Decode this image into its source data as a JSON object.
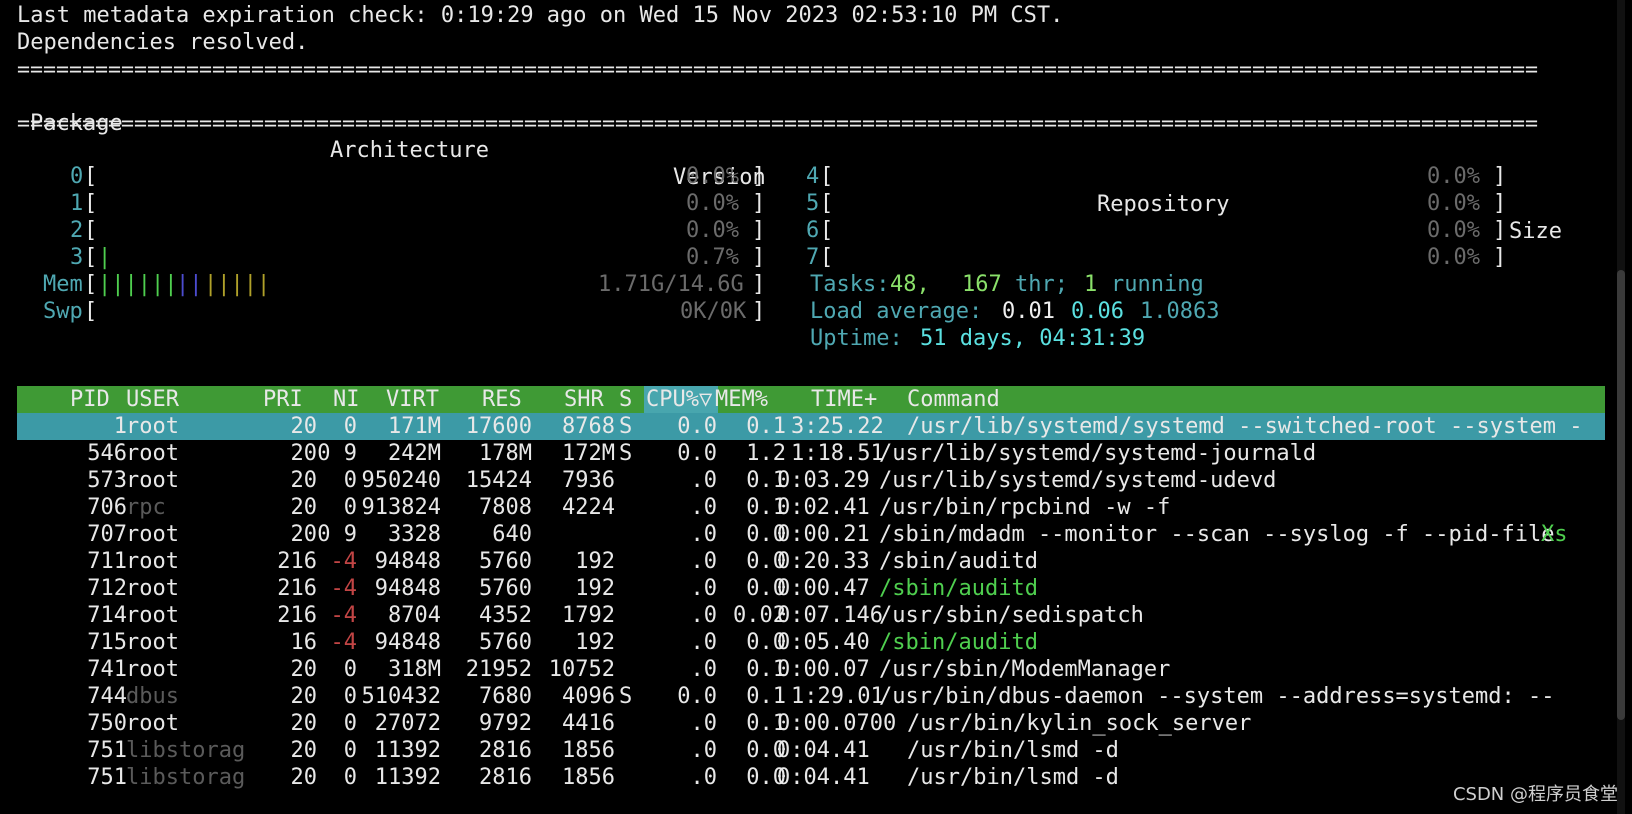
{
  "terminal": {
    "header_lines": [
      "Last metadata expiration check: 0:19:29 ago on Wed 15 Nov 2023 02:53:10 PM CST.",
      "Dependencies resolved."
    ],
    "separator": "=====================================================================================================================",
    "table_headers": {
      "package": "Package",
      "architecture": "Architecture",
      "version": "Version",
      "repository": "Repository",
      "size": "Size"
    }
  },
  "htop": {
    "cpus": [
      {
        "id": "0",
        "pct": "0.0%",
        "bar": ""
      },
      {
        "id": "1",
        "pct": "0.0%",
        "bar": ""
      },
      {
        "id": "2",
        "pct": "0.0%",
        "bar": ""
      },
      {
        "id": "3",
        "pct": "0.7%",
        "bar": "|"
      },
      {
        "id": "4",
        "pct": "0.0%",
        "bar": ""
      },
      {
        "id": "5",
        "pct": "0.0%",
        "bar": ""
      },
      {
        "id": "6",
        "pct": "0.0%",
        "bar": ""
      },
      {
        "id": "7",
        "pct": "0.0%",
        "bar": ""
      }
    ],
    "mem": {
      "label": "Mem",
      "value": "1.71G/14.6G",
      "bar_green": "||||||",
      "bar_blue": "||",
      "bar_yellow": "|||||"
    },
    "swp": {
      "label": "Swp",
      "value": "0K/0K"
    },
    "tasks": {
      "label": "Tasks:",
      "count": "48,",
      "thr": "167",
      "thr_label": "thr;",
      "running": "1",
      "running_label": "running"
    },
    "load": {
      "label": "Load average:",
      "v1": "0.01",
      "v2": "0.06",
      "v3": "1.0863"
    },
    "uptime": {
      "label": "Uptime:",
      "value": "51 days, 04:31:39"
    },
    "columns": {
      "pid": "PID",
      "user": "USER",
      "pri": "PRI",
      "ni": "NI",
      "virt": "VIRT",
      "res": "RES",
      "shr": "SHR",
      "s": "S",
      "cpu": "CPU%▽",
      "mem": "MEM%",
      "time": "TIME+",
      "command": "Command"
    },
    "processes": [
      {
        "pid": "1",
        "user": "root",
        "pri": "20",
        "ni": "0",
        "virt": "171M",
        "res": "17600",
        "shr": "8768",
        "s": "S",
        "cpu": "0.0",
        "mem": "0.1",
        "time": "3:25.22",
        "cmd": "/usr/lib/systemd/systemd --switched-root --system -"
      },
      {
        "pid": "546",
        "user": "root",
        "pri": "20",
        "ni": "0 9",
        "virt": "242M",
        "res": "178M",
        "shr": "172M",
        "s": "S",
        "cpu": "0.0",
        "mem": "1.2",
        "time": "1:18.51",
        "cmd": "/usr/lib/systemd/systemd-journald"
      },
      {
        "pid": "573",
        "user": "root",
        "pri": "20",
        "ni": "0",
        "virt": "950240",
        "res": "15424",
        "shr": "7936",
        "s": "",
        "cpu": ".0",
        "mem": "0.1",
        "time": "0:03.29",
        "cmd": "/usr/lib/systemd/systemd-udevd"
      },
      {
        "pid": "706",
        "user": "rpc",
        "pri": "20",
        "ni": "0",
        "virt": "913824",
        "res": "7808",
        "shr": "4224",
        "s": "",
        "cpu": ".0",
        "mem": "0.1",
        "time": "0:02.41",
        "cmd": "/usr/bin/rpcbind -w -f"
      },
      {
        "pid": "707",
        "user": "root",
        "pri": "20",
        "ni": "0 9",
        "virt": "3328",
        "res": "640",
        "shr": "",
        "s": "",
        "cpu": ".0",
        "mem": "0.0",
        "time": "0:00.21",
        "cmd": "/sbin/mdadm --monitor --scan --syslog -f --pid-file",
        "cmd_tail": "Xs"
      },
      {
        "pid": "711",
        "user": "root",
        "pri": "216",
        "ni": "-4",
        "virt": "94848",
        "res": "5760",
        "shr": "192",
        "s": "",
        "cpu": ".0",
        "mem": "0.0",
        "time": "0:20.33",
        "cmd": "/sbin/auditd"
      },
      {
        "pid": "712",
        "user": "root",
        "pri": "216",
        "ni": "-4",
        "virt": "94848",
        "res": "5760",
        "shr": "192",
        "s": "",
        "cpu": ".0",
        "mem": "0.0",
        "time": "0:00.47",
        "cmd": "/sbin/auditd",
        "cmd_green": true
      },
      {
        "pid": "714",
        "user": "root",
        "pri": "216",
        "ni": "-4",
        "virt": "8704",
        "res": "4352",
        "shr": "1792",
        "s": "",
        "cpu": ".0",
        "mem": "0.02",
        "time": "0:07.146",
        "cmd": "/usr/sbin/sedispatch"
      },
      {
        "pid": "715",
        "user": "root",
        "pri": "16",
        "ni": "-4",
        "virt": "94848",
        "res": "5760",
        "shr": "192",
        "s": "",
        "cpu": ".0",
        "mem": "0.0",
        "time": "0:05.40",
        "cmd": "/sbin/auditd",
        "cmd_green": true
      },
      {
        "pid": "741",
        "user": "root",
        "pri": "20",
        "ni": "0",
        "virt": "318M",
        "res": "21952",
        "shr": "10752",
        "s": "",
        "cpu": ".0",
        "mem": "0.1",
        "time": "0:00.07",
        "cmd": "/usr/sbin/ModemManager"
      },
      {
        "pid": "744",
        "user": "dbus",
        "pri": "20",
        "ni": "0",
        "virt": "510432",
        "res": "7680",
        "shr": "4096",
        "s": "S",
        "cpu": "0.0",
        "mem": "0.1",
        "time": "1:29.01",
        "cmd": "/usr/bin/dbus-daemon --system --address=systemd: --"
      },
      {
        "pid": "750",
        "user": "root",
        "pri": "20",
        "ni": "0",
        "virt": "27072",
        "res": "9792",
        "shr": "4416",
        "s": "",
        "cpu": ".0",
        "mem": "0.1",
        "time": "0:00.0700",
        "cmd": "/usr/bin/kylin_sock_server"
      },
      {
        "pid": "751",
        "user": "libstorag",
        "pri": "20",
        "ni": "0",
        "virt": "11392",
        "res": "2816",
        "shr": "1856",
        "s": "",
        "cpu": ".0",
        "mem": "0.0",
        "time": "0:04.41",
        "cmd": "/usr/bin/lsmd -d"
      },
      {
        "pid": "751",
        "user": "libstorag",
        "pri": "20",
        "ni": "0",
        "virt": "11392",
        "res": "2816",
        "shr": "1856",
        "s": "",
        "cpu": ".0",
        "mem": "0.0",
        "time": "0:04.41",
        "cmd": "/usr/bin/lsmd -d"
      }
    ]
  },
  "watermark": "CSDN @程序员食堂"
}
